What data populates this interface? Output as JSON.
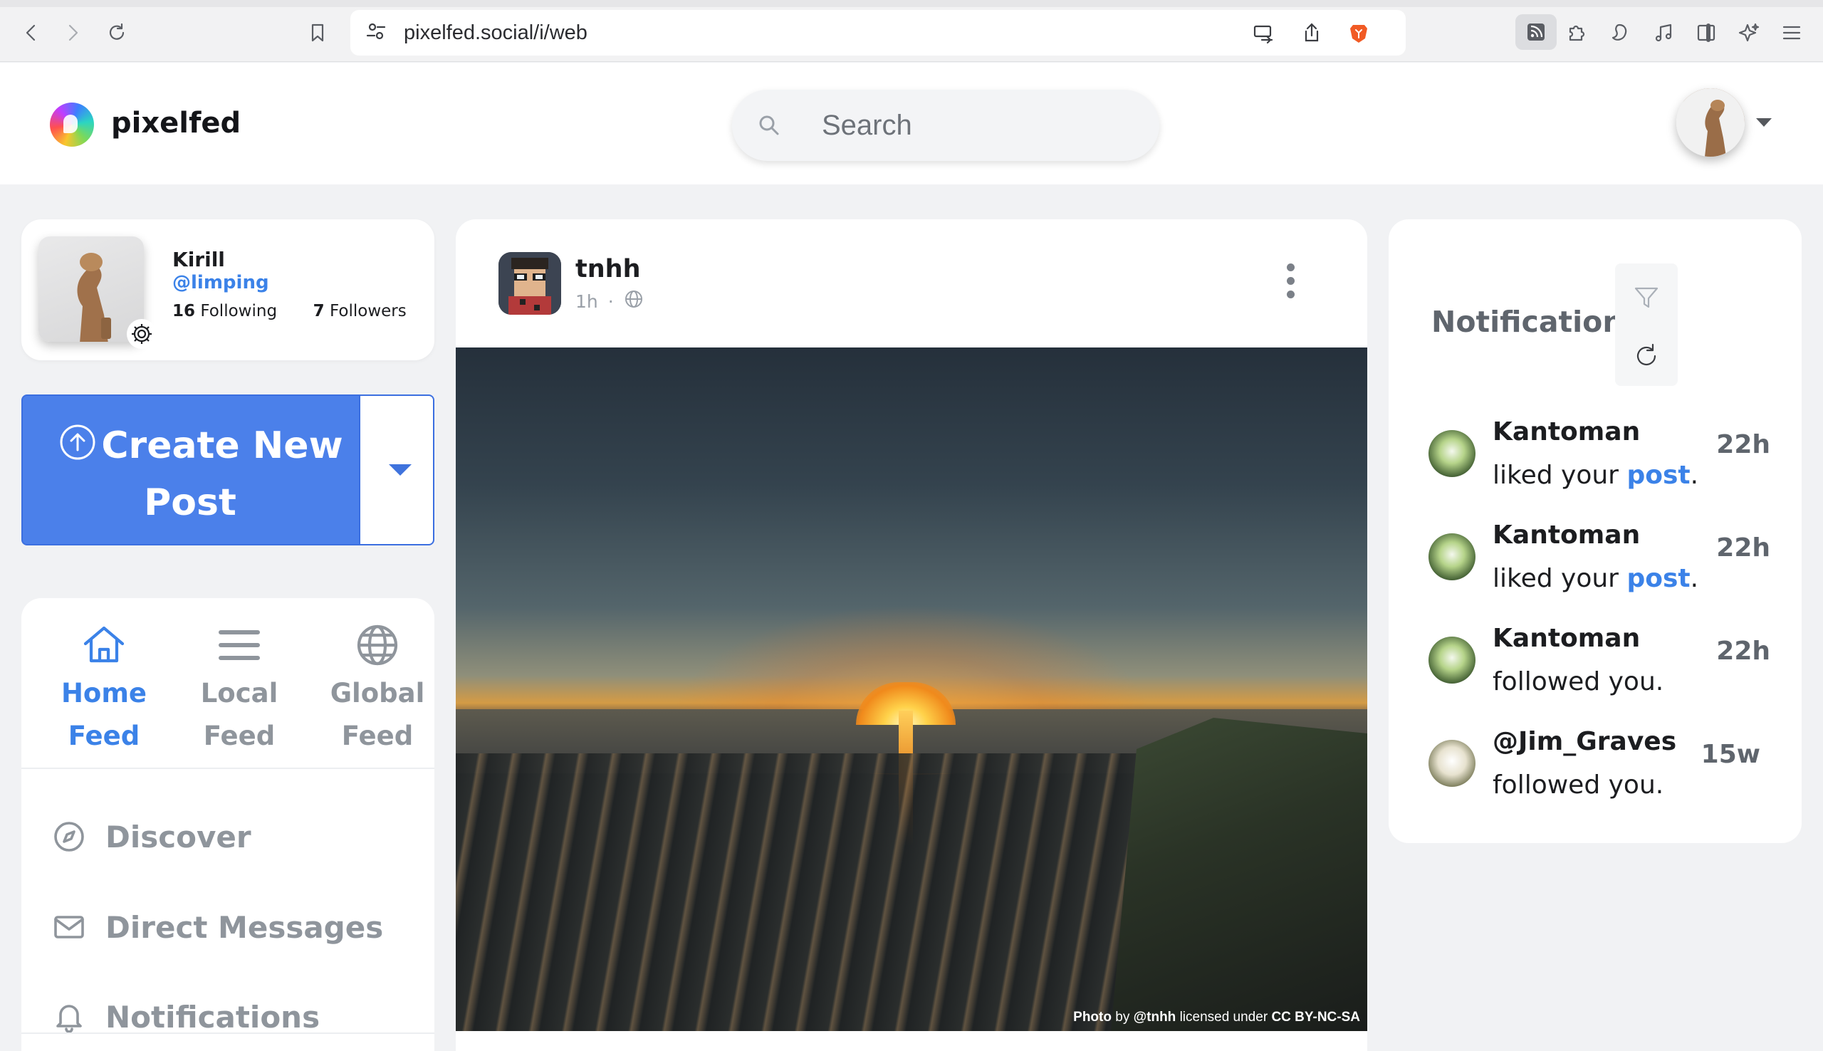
{
  "browser": {
    "url": "pixelfed.social/i/web",
    "icons": [
      "back-icon",
      "forward-icon",
      "reload-icon",
      "bookmark-icon",
      "site-settings-icon",
      "cast-icon",
      "share-icon",
      "brave-shield-icon",
      "rss-icon",
      "extensions-icon",
      "leo-icon",
      "media-icon",
      "sidebar-icon",
      "ai-icon",
      "menu-icon"
    ]
  },
  "header": {
    "brand": "pixelfed",
    "search_placeholder": "Search"
  },
  "profile": {
    "name": "Kirill",
    "handle": "@limping",
    "following_count": "16",
    "following_label": "Following",
    "followers_count": "7",
    "followers_label": "Followers"
  },
  "create": {
    "line1": "Create New",
    "line2": "Post"
  },
  "feeds": [
    {
      "line1": "Home",
      "line2": "Feed",
      "active": true
    },
    {
      "line1": "Local",
      "line2": "Feed",
      "active": false
    },
    {
      "line1": "Global",
      "line2": "Feed",
      "active": false
    }
  ],
  "nav": [
    {
      "label": "Discover",
      "icon": "compass-icon"
    },
    {
      "label": "Direct Messages",
      "icon": "envelope-icon"
    },
    {
      "label": "Notifications",
      "icon": "bell-icon"
    }
  ],
  "post": {
    "user": "tnhh",
    "time": "1h",
    "separator": "·",
    "credit_prefix": "Photo",
    "credit_by": "by",
    "credit_user": "@tnhh",
    "credit_mid": "licensed under",
    "credit_license": "CC BY-NC-SA"
  },
  "notifications": {
    "title": "Notifications",
    "items": [
      {
        "actor": "Kantoman",
        "action1": "liked",
        "action2": "your",
        "link": "post",
        "end": ".",
        "time": "22h"
      },
      {
        "actor": "Kantoman",
        "action1": "liked",
        "action2": "your",
        "link": "post",
        "end": ".",
        "time": "22h"
      },
      {
        "actor": "Kantoman",
        "action1": "",
        "action2": "followed you.",
        "link": "",
        "end": "",
        "time": "22h"
      },
      {
        "actor": "@Jim_Graves",
        "action1": "",
        "action2": "followed you.",
        "link": "",
        "end": "",
        "time": "15w"
      }
    ]
  }
}
